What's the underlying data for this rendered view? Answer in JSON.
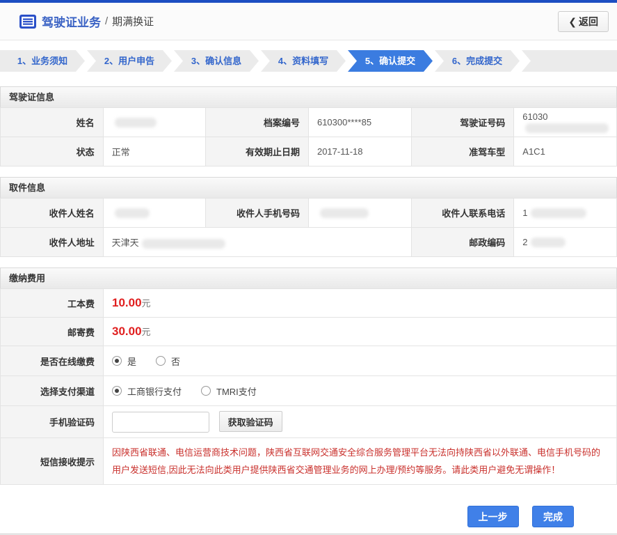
{
  "header": {
    "title": "驾驶证业务",
    "separator": "/",
    "subtitle": "期满换证",
    "back_chevron": "❮",
    "back_label": "返回"
  },
  "steps": {
    "active_index": 4,
    "items": [
      {
        "label": "1、业务须知",
        "active": false
      },
      {
        "label": "2、用户申告",
        "active": false
      },
      {
        "label": "3、确认信息",
        "active": false
      },
      {
        "label": "4、资料填写",
        "active": false
      },
      {
        "label": "5、确认提交",
        "active": true
      },
      {
        "label": "6、完成提交",
        "active": false
      }
    ]
  },
  "license": {
    "title": "驾驶证信息",
    "row1": {
      "c1_label": "姓名",
      "c1_value": "",
      "c2_label": "档案编号",
      "c2_value": "610300****85",
      "c3_label": "驾驶证号码",
      "c3_value": "61030"
    },
    "row2": {
      "c1_label": "状态",
      "c1_value": "正常",
      "c2_label": "有效期止日期",
      "c2_value": "2017-11-18",
      "c3_label": "准驾车型",
      "c3_value": "A1C1"
    }
  },
  "pickup": {
    "title": "取件信息",
    "row1": {
      "c1_label": "收件人姓名",
      "c1_value": "",
      "c2_label": "收件人手机号码",
      "c2_value": "",
      "c3_label": "收件人联系电话",
      "c3_value": "1"
    },
    "row2": {
      "c1_label": "收件人地址",
      "c1_value": "天津天",
      "c2_label": "邮政编码",
      "c2_value": "2"
    }
  },
  "fees": {
    "title": "缴纳费用",
    "production_fee": {
      "label": "工本费",
      "amount": "10.00",
      "unit": "元"
    },
    "postage_fee": {
      "label": "邮寄费",
      "amount": "30.00",
      "unit": "元"
    },
    "online_payment": {
      "label": "是否在线缴费",
      "option_yes": "是",
      "option_no": "否",
      "selected": "是"
    },
    "payment_channel": {
      "label": "选择支付渠道",
      "option_icbc": "工商银行支付",
      "option_tmri": "TMRI支付",
      "selected": "工商银行支付"
    },
    "sms_code": {
      "label": "手机验证码",
      "input_value": "",
      "button_label": "获取验证码"
    },
    "sms_notice": {
      "label": "短信接收提示",
      "text": "因陕西省联通、电信运营商技术问题，陕西省互联网交通安全综合服务管理平台无法向持陕西省以外联通、电信手机号码的用户发送短信,因此无法向此类用户提供陕西省交通管理业务的网上办理/预约等服务。请此类用户避免无谓操作！"
    }
  },
  "footer": {
    "prev_label": "上一步",
    "finish_label": "完成"
  },
  "colors": {
    "accent_blue": "#3b7ce0",
    "top_bar": "#1d4ec2",
    "step_text": "#3366cc",
    "fee_red": "#e01f1f",
    "notice_red": "#c9302c"
  }
}
